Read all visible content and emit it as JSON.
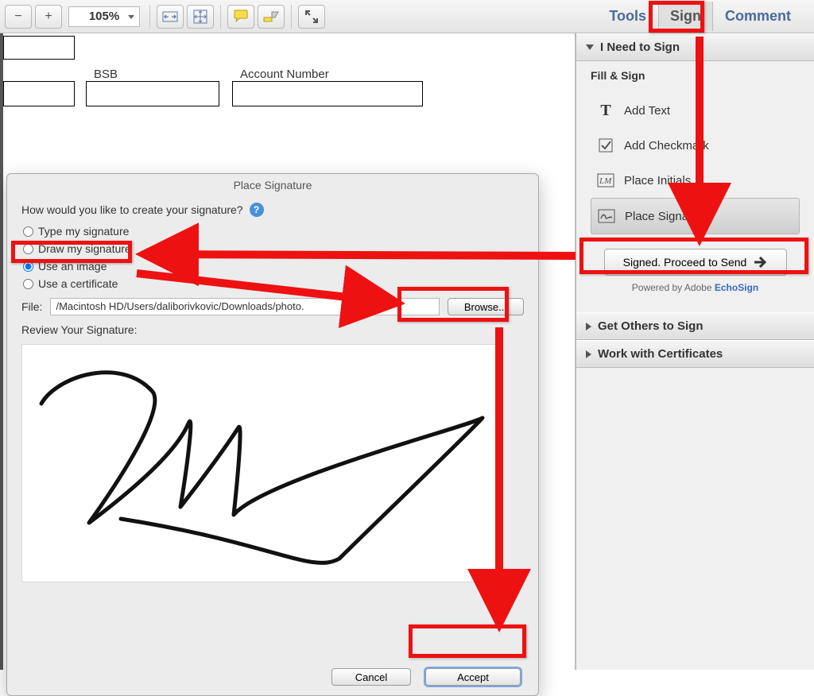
{
  "toolbar": {
    "zoom": "105%",
    "tabs": {
      "tools": "Tools",
      "sign": "Sign",
      "comment": "Comment"
    }
  },
  "document": {
    "field1": "BSB",
    "field2": "Account Number"
  },
  "dialog": {
    "title": "Place Signature",
    "prompt": "How would you like to create your signature?",
    "options": {
      "type": "Type my signature",
      "draw": "Draw my signature",
      "image": "Use an image",
      "cert": "Use a certificate"
    },
    "file_label": "File:",
    "file_path": "/Macintosh HD/Users/daliborivkovic/Downloads/photo.",
    "browse": "Browse...",
    "review": "Review Your Signature:",
    "cancel": "Cancel",
    "accept": "Accept"
  },
  "panel": {
    "need_sign": "I Need to Sign",
    "fill_sign": "Fill & Sign",
    "add_text": "Add Text",
    "add_check": "Add Checkmark",
    "place_initials": "Place Initials",
    "place_signature": "Place Signature",
    "proceed": "Signed. Proceed to Send",
    "powered_prefix": "Powered by Adobe ",
    "powered_link": "EchoSign",
    "get_others": "Get Others to Sign",
    "work_certs": "Work with Certificates"
  }
}
